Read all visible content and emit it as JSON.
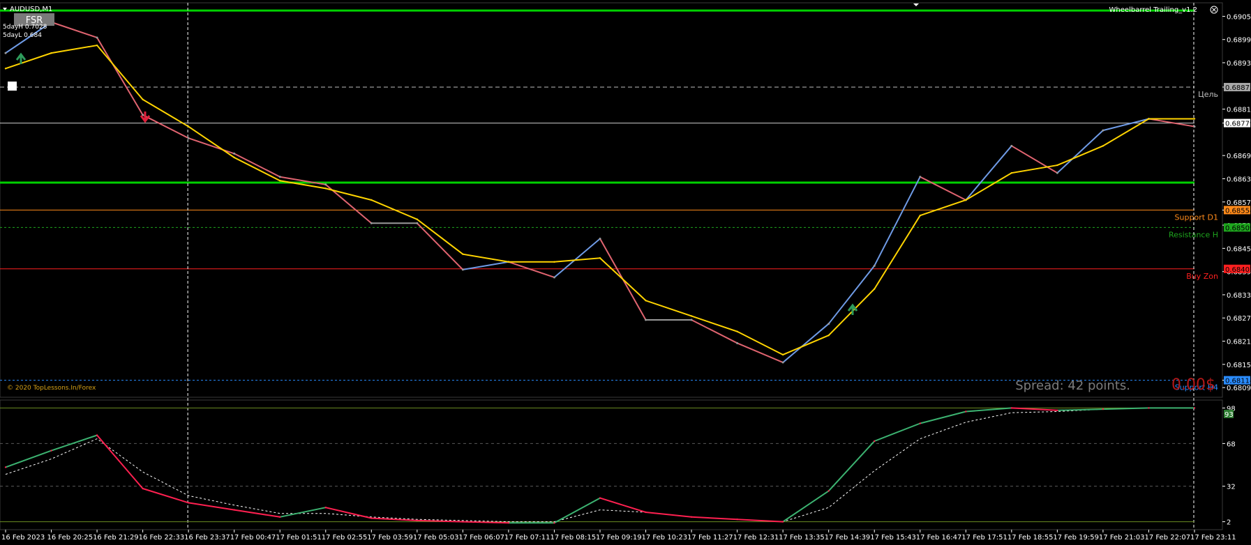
{
  "window": {
    "symbol_title": "AUDUSD,M1",
    "fsr_button": "FSR",
    "five_day_high": "5dayH 0.7028",
    "five_day_low": "5dayL 0.684",
    "indicator_name": "Wheelbarrel Trailing_v1.2",
    "copyright": "© 2020 TopLessons.In/Forex",
    "spread_text": "Spread: 42 points.",
    "profit_text": "0.00$"
  },
  "colors": {
    "background": "#000000",
    "ma_line": "#ffd400",
    "price_up": "#6f9be6",
    "price_down": "#e06470",
    "price_neutral": "#9a9a9a",
    "green_level": "#00d000",
    "support_d1": "#ff8a1a",
    "resistance_h": "#1ea61e",
    "buy_zone": "#ff2020",
    "support_h4": "#2a8cff",
    "osc_main": "#ff2050",
    "osc_main_up": "#3cb371",
    "osc_signal": "#ffffff"
  },
  "chart_data": [
    {
      "type": "line",
      "title": "",
      "xlabel": "",
      "ylabel": "",
      "ylim": [
        0.6807,
        0.6909
      ],
      "grid": false,
      "legend": "none",
      "y_ticks": [
        "0.69055",
        "0.68995",
        "0.68935",
        "0.68872",
        "0.68815",
        "0.68779",
        "0.68695",
        "0.68635",
        "0.68575",
        "0.68554",
        "0.68515",
        "0.68455",
        "0.68395",
        "0.68335",
        "0.68275",
        "0.68215",
        "0.68155",
        "0.68114",
        "0.68095"
      ],
      "x_ticks": [
        "16 Feb 2023",
        "16 Feb 20:25",
        "16 Feb 21:29",
        "16 Feb 22:33",
        "16 Feb 23:37",
        "17 Feb 00:47",
        "17 Feb 01:51",
        "17 Feb 02:55",
        "17 Feb 03:59",
        "17 Feb 05:03",
        "17 Feb 06:07",
        "17 Feb 07:11",
        "17 Feb 08:15",
        "17 Feb 09:19",
        "17 Feb 10:23",
        "17 Feb 11:27",
        "17 Feb 12:31",
        "17 Feb 13:35",
        "17 Feb 14:39",
        "17 Feb 15:43",
        "17 Feb 16:47",
        "17 Feb 17:51",
        "17 Feb 18:55",
        "17 Feb 19:59",
        "17 Feb 21:03",
        "17 Feb 22:07",
        "17 Feb 23:11"
      ],
      "x": [
        0,
        1,
        2,
        3,
        4,
        5,
        6,
        7,
        8,
        9,
        10,
        11,
        12,
        13,
        14,
        15,
        16,
        17,
        18,
        19,
        20,
        21,
        22,
        23,
        24,
        25,
        26
      ],
      "series": [
        {
          "values": [
            0.6896,
            0.6904,
            0.69,
            0.688,
            0.6874,
            0.687,
            0.6864,
            0.6862,
            0.6852,
            0.6852,
            0.684,
            0.6842,
            0.6838,
            0.6848,
            0.6827,
            0.6827,
            0.6821,
            0.6816,
            0.6826,
            0.6841,
            0.6864,
            0.6858,
            0.6872,
            0.6865,
            0.6876,
            0.6879,
            0.6877
          ]
        },
        {
          "values": [
            0.6892,
            0.6896,
            0.6898,
            0.6884,
            0.6877,
            0.6869,
            0.6863,
            0.6861,
            0.6858,
            0.6853,
            0.6844,
            0.6842,
            0.6842,
            0.6843,
            0.6832,
            0.6828,
            0.6824,
            0.6818,
            0.6823,
            0.6835,
            0.6854,
            0.6858,
            0.6865,
            0.6867,
            0.6872,
            0.6879,
            0.6879
          ]
        }
      ],
      "levels": [
        {
          "name": "",
          "value": 0.6907
        },
        {
          "name": "Цель",
          "value": 0.68872
        },
        {
          "name": "",
          "value": 0.68779
        },
        {
          "name": "",
          "value": 0.68625
        },
        {
          "name": "Support D1",
          "value": 0.68554
        },
        {
          "name": "Resistance H",
          "value": 0.68509
        },
        {
          "name": "Buy Zon",
          "value": 0.68402
        },
        {
          "name": "Support H4",
          "value": 0.68114
        }
      ],
      "level_tags": [
        "0.68872",
        "0.68779",
        "0.68554",
        "0.68509",
        "0.68402",
        "0.68114"
      ],
      "vertical_markers": [
        4,
        26
      ]
    },
    {
      "type": "line",
      "title": "",
      "ylim": [
        0,
        100
      ],
      "y_ticks": [
        "98",
        "68",
        "32",
        "2"
      ],
      "current_value": "93",
      "x": [
        0,
        1,
        2,
        3,
        4,
        5,
        6,
        7,
        8,
        9,
        10,
        11,
        12,
        13,
        14,
        15,
        16,
        17,
        18,
        19,
        20,
        21,
        22,
        23,
        24,
        25,
        26
      ],
      "series": [
        {
          "values": [
            48,
            62,
            75,
            30,
            18,
            12,
            6,
            14,
            5,
            3,
            2,
            1,
            1,
            22,
            10,
            6,
            4,
            2,
            28,
            70,
            85,
            95,
            98,
            96,
            97,
            98,
            98
          ]
        },
        {
          "values": [
            42,
            55,
            72,
            44,
            24,
            16,
            9,
            9,
            6,
            4,
            3,
            2,
            2,
            12,
            10,
            6,
            4,
            2,
            14,
            45,
            72,
            86,
            94,
            95,
            97,
            98,
            98
          ]
        }
      ]
    }
  ]
}
